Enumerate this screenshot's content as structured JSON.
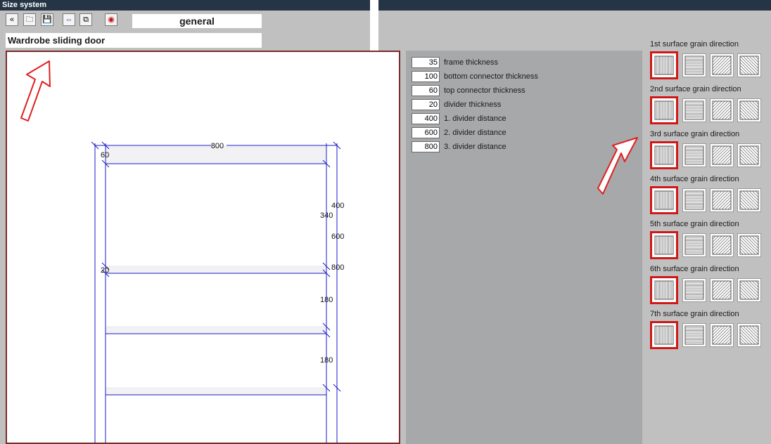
{
  "window": {
    "title": "Size system"
  },
  "toolbar": {
    "buttons": [
      {
        "name": "back-button",
        "icon": "double-chevron-left-icon",
        "glyph": "«"
      },
      {
        "name": "open-button",
        "icon": "open-document-icon",
        "glyph": "🗀"
      },
      {
        "name": "save-button",
        "icon": "floppy-disk-icon",
        "glyph": "💾"
      },
      {
        "name": "fit-size-button",
        "icon": "resize-fit-icon",
        "glyph": "⇔"
      },
      {
        "name": "copy-button",
        "icon": "copy-pages-icon",
        "glyph": "⧉"
      },
      {
        "name": "help-button",
        "icon": "lifebuoy-icon",
        "glyph": "◉"
      }
    ],
    "mode": "general"
  },
  "item": {
    "name": "Wardrobe sliding door"
  },
  "drawing": {
    "dim_top": "800",
    "dim_frame": "60",
    "dim_div_right_1": "400",
    "dim_inner_1": "340",
    "dim_div_right_2": "600",
    "dim_divider": "20",
    "dim_div_right_3": "800",
    "dim_section_2": "180",
    "dim_section_3": "180"
  },
  "params": [
    {
      "value": "35",
      "label": "frame thickness"
    },
    {
      "value": "100",
      "label": "bottom connector thickness"
    },
    {
      "value": "60",
      "label": "top connector thickness"
    },
    {
      "value": "20",
      "label": "divider thickness"
    },
    {
      "value": "400",
      "label": "1. divider distance"
    },
    {
      "value": "600",
      "label": "2. divider distance"
    },
    {
      "value": "800",
      "label": "3. divider distance"
    }
  ],
  "grain": {
    "options": [
      "vertical",
      "horizontal",
      "diagonal-right",
      "diagonal-left"
    ],
    "surfaces": [
      {
        "label": "1st surface grain direction",
        "selected": 0
      },
      {
        "label": "2nd surface grain direction",
        "selected": 0
      },
      {
        "label": "3rd surface grain direction",
        "selected": 0
      },
      {
        "label": "4th surface grain direction",
        "selected": 0
      },
      {
        "label": "5th surface grain direction",
        "selected": 0
      },
      {
        "label": "6th surface grain direction",
        "selected": 0
      },
      {
        "label": "7th surface grain direction",
        "selected": 0
      }
    ]
  },
  "colors": {
    "titlebar": "#253545",
    "selection": "#d01818",
    "drawing_lines": "#1a1acc",
    "annotation_arrow": "#e02020"
  }
}
